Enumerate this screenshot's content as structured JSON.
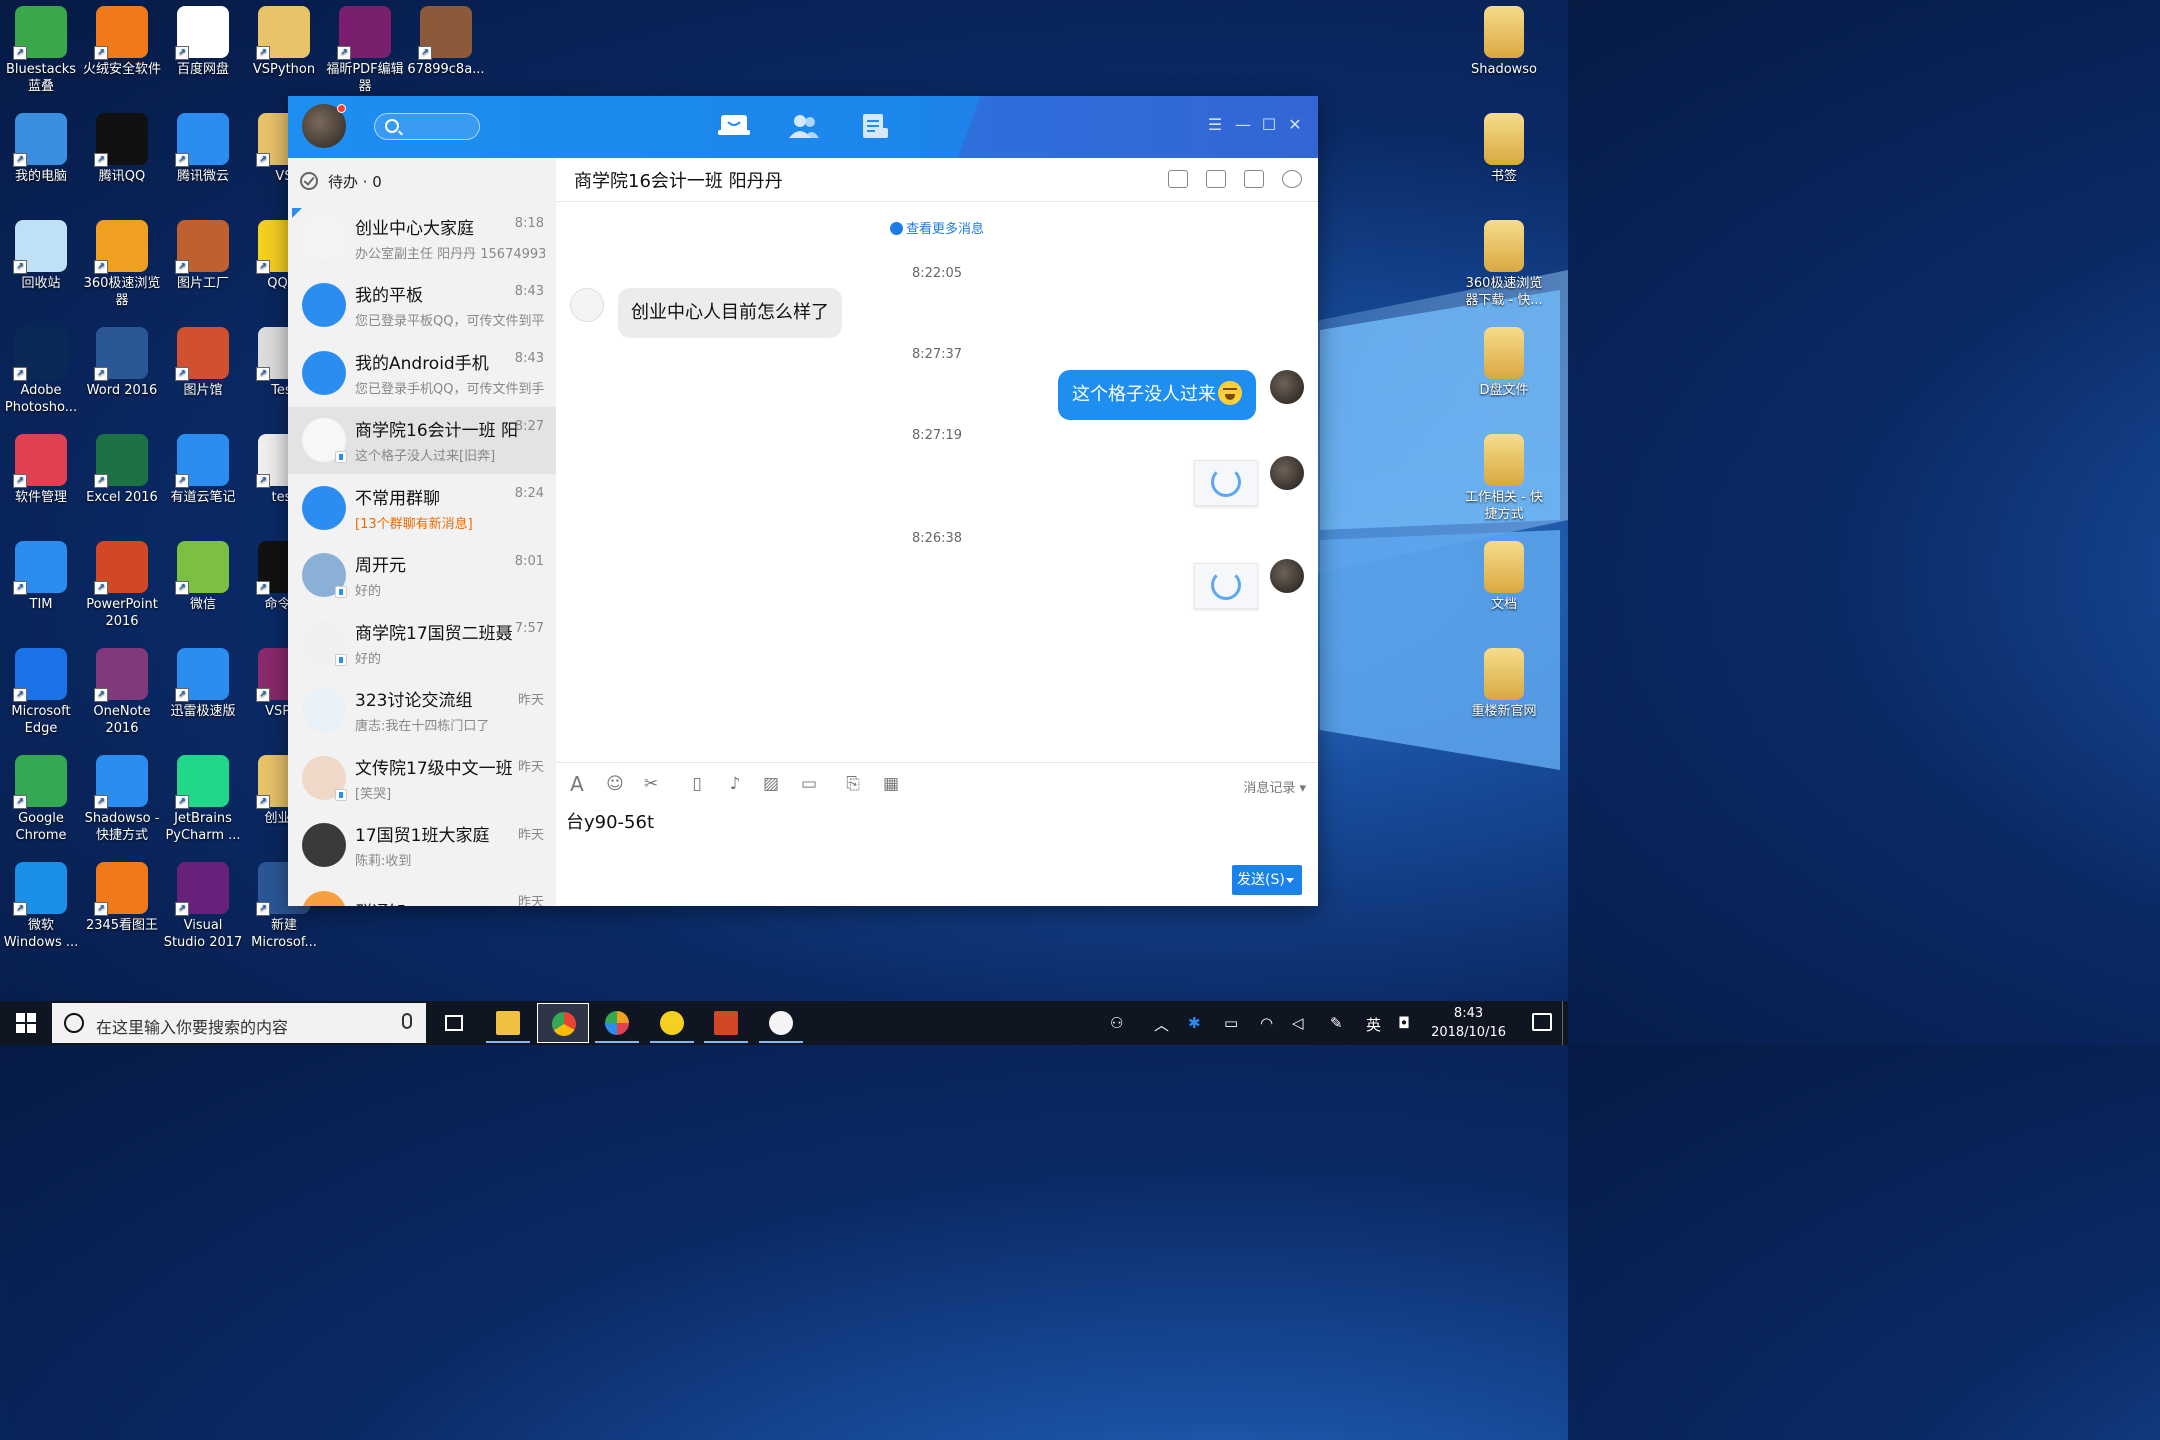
{
  "desktop": {
    "left_icons": [
      {
        "label": "Bluestacks蓝叠",
        "icon": "bluestacks-icon",
        "color": "#3aa84a"
      },
      {
        "label": "火绒安全软件",
        "icon": "huorong-icon",
        "color": "#f07a1a"
      },
      {
        "label": "百度网盘",
        "icon": "baidu-netdisk-icon",
        "color": "#ffffff"
      },
      {
        "label": "VSPython",
        "icon": "folder-icon",
        "color": "#e8c36a"
      },
      {
        "label": "福昕PDF编辑器",
        "icon": "foxit-pdf-icon",
        "color": "#7a1f6e"
      },
      {
        "label": "67899c8a...",
        "icon": "image-file-icon",
        "color": "#8a5a3a"
      },
      {
        "label": "我的电脑",
        "icon": "computer-icon",
        "color": "#3a8fe0"
      },
      {
        "label": "腾讯QQ",
        "icon": "qq-penguin-icon",
        "color": "#111111"
      },
      {
        "label": "腾讯微云",
        "icon": "weiyun-icon",
        "color": "#2b8df0"
      },
      {
        "label": "VS",
        "icon": "folder-icon",
        "color": "#e8c36a"
      },
      {
        "label": "回收站",
        "icon": "recycle-bin-icon",
        "color": "#bfe1f5"
      },
      {
        "label": "360极速浏览器",
        "icon": "360-browser-icon",
        "color": "#f0a020"
      },
      {
        "label": "图片工厂",
        "icon": "picture-factory-icon",
        "color": "#c06030"
      },
      {
        "label": "QQ音",
        "icon": "qq-music-icon",
        "color": "#f5d020"
      },
      {
        "label": "Adobe Photosho...",
        "icon": "photoshop-icon",
        "color": "#0a2a55"
      },
      {
        "label": "Word 2016",
        "icon": "word-icon",
        "color": "#2b5797"
      },
      {
        "label": "图片馆",
        "icon": "photo-gallery-icon",
        "color": "#d05030"
      },
      {
        "label": "Test",
        "icon": "file-icon",
        "color": "#dddddd"
      },
      {
        "label": "软件管理",
        "icon": "software-manager-icon",
        "color": "#e04050"
      },
      {
        "label": "Excel 2016",
        "icon": "excel-icon",
        "color": "#1e7145"
      },
      {
        "label": "有道云笔记",
        "icon": "youdao-note-icon",
        "color": "#2b8df0"
      },
      {
        "label": "test",
        "icon": "text-file-icon",
        "color": "#eeeeee"
      },
      {
        "label": "TIM",
        "icon": "tim-icon",
        "color": "#2b8df0"
      },
      {
        "label": "PowerPoint 2016",
        "icon": "powerpoint-icon",
        "color": "#d24726"
      },
      {
        "label": "微信",
        "icon": "wechat-icon",
        "color": "#7bc043"
      },
      {
        "label": "命令提",
        "icon": "cmd-icon",
        "color": "#111111"
      },
      {
        "label": "Microsoft Edge",
        "icon": "edge-icon",
        "color": "#1a73e8"
      },
      {
        "label": "OneNote 2016",
        "icon": "onenote-icon",
        "color": "#80397b"
      },
      {
        "label": "迅雷极速版",
        "icon": "thunder-icon",
        "color": "#2b8df0"
      },
      {
        "label": "VSPyt",
        "icon": "winrar-icon",
        "color": "#8a2a6a"
      },
      {
        "label": "Google Chrome",
        "icon": "chrome-icon",
        "color": "#34a853"
      },
      {
        "label": "Shadowso - 快捷方式",
        "icon": "shadowsocks-icon",
        "color": "#2b8df0"
      },
      {
        "label": "JetBrains PyCharm ...",
        "icon": "pycharm-icon",
        "color": "#21d789"
      },
      {
        "label": "创业宣",
        "icon": "folder-icon",
        "color": "#e8c36a"
      },
      {
        "label": "微软 Windows ...",
        "icon": "windows-icon",
        "color": "#1a8fe8"
      },
      {
        "label": "2345看图王",
        "icon": "2345-viewer-icon",
        "color": "#f07a1a"
      },
      {
        "label": "Visual Studio 2017",
        "icon": "visual-studio-icon",
        "color": "#68217a"
      },
      {
        "label": "新建 Microsof...",
        "icon": "word-doc-icon",
        "color": "#2b5797"
      }
    ],
    "right_icons": [
      {
        "label": "Shadowso",
        "icon": "folder-icon"
      },
      {
        "label": "书签",
        "icon": "chrome-folder-icon"
      },
      {
        "label": "360极速浏览器下载 - 快...",
        "icon": "folder-shortcut-icon"
      },
      {
        "label": "D盘文件",
        "icon": "folder-shortcut-icon"
      },
      {
        "label": "工作相关 - 快捷方式",
        "icon": "folder-shortcut-icon"
      },
      {
        "label": "文档",
        "icon": "folder-shortcut-icon"
      },
      {
        "label": "重楼新官网",
        "icon": "folder-shortcut-icon"
      }
    ]
  },
  "qq": {
    "todo_label": "待办 · 0",
    "conversations": [
      {
        "name": "创业中心大家庭",
        "time": "8:18",
        "preview": "办公室副主任 阳丹丹 15674993",
        "av": "#f4f4f4",
        "selected": false,
        "orange": false
      },
      {
        "name": "我的平板",
        "time": "8:43",
        "preview": "您已登录平板QQ，可传文件到平",
        "av": "#2b8df0",
        "selected": false,
        "orange": false
      },
      {
        "name": "我的Android手机",
        "time": "8:43",
        "preview": "您已登录手机QQ，可传文件到手",
        "av": "#2b8df0",
        "selected": false,
        "orange": false
      },
      {
        "name": "商学院16会计一班 阳",
        "time": "8:27",
        "preview": "这个格子没人过来[旧奔]",
        "av": "#f7f7f7",
        "selected": true,
        "orange": false
      },
      {
        "name": "不常用群聊",
        "time": "8:24",
        "preview": "[13个群聊有新消息]",
        "av": "#2b8df0",
        "selected": false,
        "orange": true
      },
      {
        "name": "周开元",
        "time": "8:01",
        "preview": "好的",
        "av": "#8ab0d8",
        "selected": false,
        "orange": false
      },
      {
        "name": "商学院17国贸二班聂",
        "time": "7:57",
        "preview": "好的",
        "av": "#f0f0f0",
        "selected": false,
        "orange": false
      },
      {
        "name": "323讨论交流组",
        "time": "昨天",
        "preview": "唐志:我在十四栋门口了",
        "av": "#e8f0f8",
        "selected": false,
        "orange": false
      },
      {
        "name": "文传院17级中文一班",
        "time": "昨天",
        "preview": "[笑哭]",
        "av": "#f0d8c8",
        "selected": false,
        "orange": false
      },
      {
        "name": "17国贸1班大家庭",
        "time": "昨天",
        "preview": "陈莉:收到",
        "av": "#3a3a3a",
        "selected": false,
        "orange": false
      },
      {
        "name": "群通知",
        "time": "昨天",
        "preview": "",
        "av": "#f5a040",
        "selected": false,
        "orange": false
      }
    ],
    "chat": {
      "title": "商学院16会计一班 阳丹丹",
      "more_messages": "查看更多消息",
      "ts1": "8:22:05",
      "msg1": "创业中心人目前怎么样了",
      "ts2": "8:27:37",
      "msg2": "这个格子没人过来",
      "ts3": "8:27:19",
      "ts4": "8:26:38",
      "history": "消息记录",
      "input": "台y90-56t",
      "send": "发送(S)"
    }
  },
  "taskbar": {
    "search_placeholder": "在这里输入你要搜索的内容",
    "ime": "英",
    "time": "8:43",
    "date": "2018/10/16"
  }
}
